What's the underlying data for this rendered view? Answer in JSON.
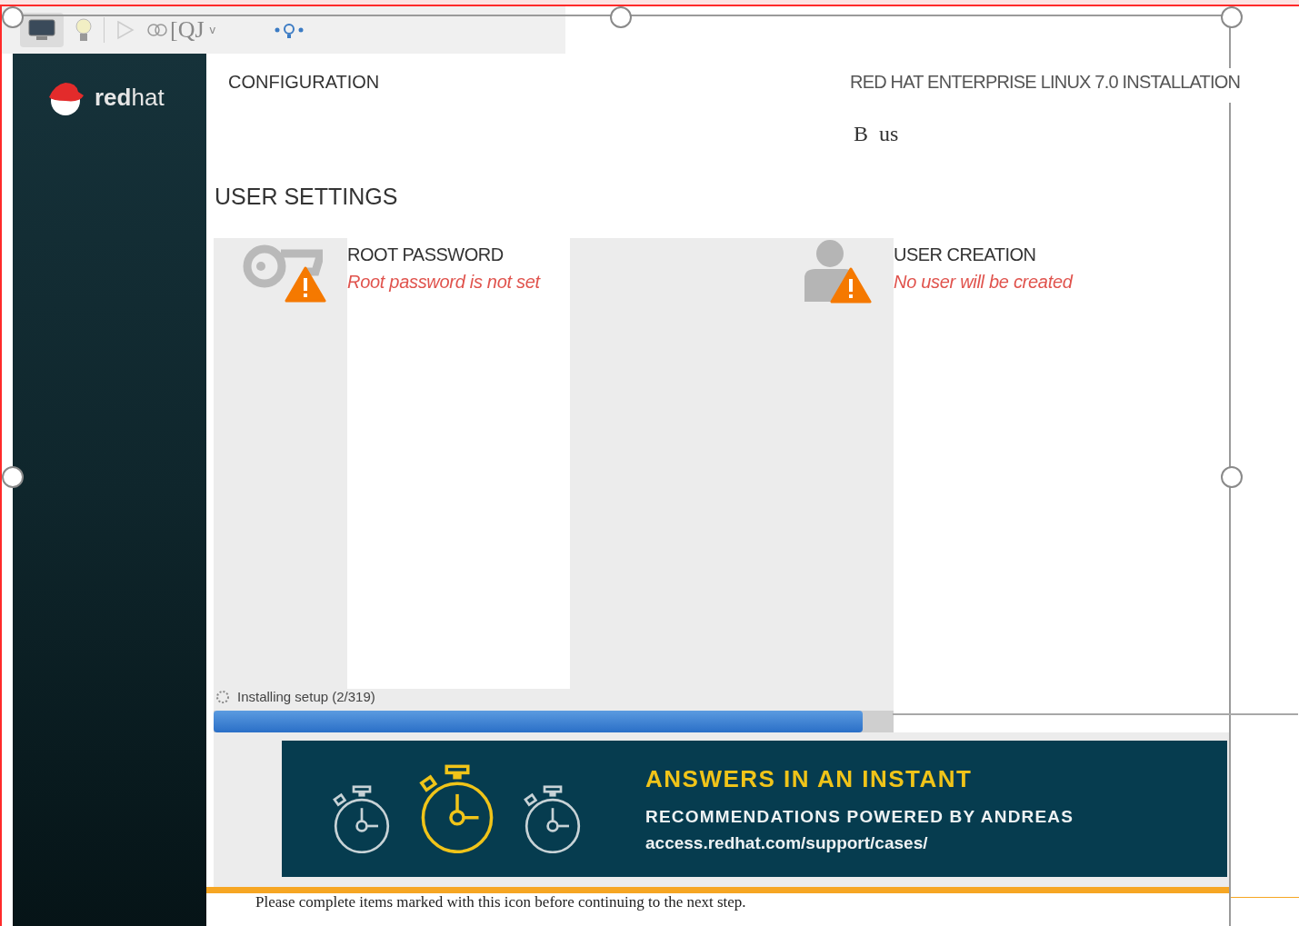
{
  "toolbar": {
    "label": "[QJ",
    "dropdown": "v"
  },
  "logo": {
    "text": "**red**hat"
  },
  "header": {
    "left_title": "CONFIGURATION",
    "right_title": "RED HAT ENTERPRISE LINUX 7.0 INSTALLATION",
    "keyboard": "B  us"
  },
  "section": {
    "title": "USER SETTINGS"
  },
  "spokes": [
    {
      "kind": "key",
      "title": "ROOT PASSWORD",
      "status": "Root password is not set",
      "warning": true
    },
    {
      "kind": "user",
      "title": "USER CREATION",
      "status": "No user will be created",
      "warning": true
    }
  ],
  "progress": {
    "label": "Installing setup (2/319)",
    "level": 0.955
  },
  "banner": {
    "headline": "ANSWERS IN AN INSTANT",
    "subline": "RECOMMENDATIONS POWERED BY ANDREAS",
    "url": "access.redhat.com/support/cases/"
  },
  "footer": {
    "message": "Please complete items marked with this icon before continuing to the next step."
  }
}
